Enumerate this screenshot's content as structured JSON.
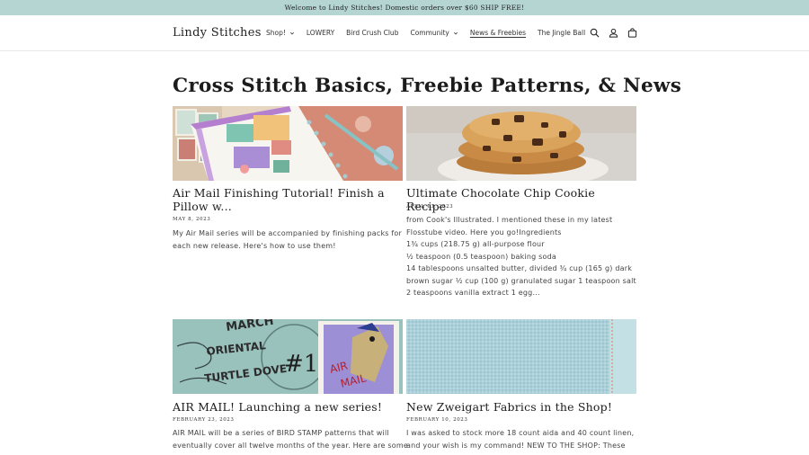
{
  "announcement": "Welcome to Lindy Stitches! Domestic orders over $60 SHIP FREE!",
  "header": {
    "logo": "Lindy Stitches",
    "nav": [
      {
        "label": "Shop!",
        "has_dropdown": true,
        "active": false
      },
      {
        "label": "LOWERY",
        "has_dropdown": false,
        "active": false
      },
      {
        "label": "Bird Crush Club",
        "has_dropdown": false,
        "active": false
      },
      {
        "label": "Community",
        "has_dropdown": true,
        "active": false
      },
      {
        "label": "News & Freebies",
        "has_dropdown": false,
        "active": true
      },
      {
        "label": "The Jingle Ball",
        "has_dropdown": false,
        "active": false
      }
    ],
    "icons": [
      "search-icon",
      "account-icon",
      "cart-icon"
    ]
  },
  "page_title": "Cross Stitch Basics, Freebie Patterns, & News",
  "articles": [
    {
      "title_lines": [
        "Air Mail Finishing Tutorial! Finish a",
        "Pillow w..."
      ],
      "date": "MAY 8, 2023",
      "excerpt_lines": [
        "My Air Mail series will be accompanied by finishing packs for",
        "each new release.  Here's how to use them!"
      ],
      "image": "cross-stitch-pillow-image"
    },
    {
      "title_lines": [
        "Ultimate Chocolate Chip Cookie Recipe"
      ],
      "date": "APRIL 13, 2023",
      "excerpt_lines": [
        "from Cook's Illustrated.  I mentioned these in my latest",
        "Flosstube video.  Here you go!Ingredients",
        "1¾ cups (218.75 g) all-purpose flour",
        "½ teaspoon (0.5 teaspoon) baking soda",
        "14 tablespoons unsalted butter, divided ¾ cup (165 g) dark",
        "brown sugar ½ cup (100 g) granulated sugar 1 teaspoon salt",
        "2 teaspoons vanilla extract 1 egg..."
      ],
      "image": "cookie-image"
    },
    {
      "title_lines": [
        "AIR MAIL! Launching a new series!"
      ],
      "date": "FEBRUARY 23, 2023",
      "excerpt_lines": [
        "AIR MAIL will be a series of BIRD STAMP patterns that will",
        "eventually cover all twelve months of the year.  Here are some"
      ],
      "image": "air-mail-stamp-image",
      "image_text": {
        "month": "MARCH",
        "line1": "ORIENTAL",
        "line2": "TURTLE DOVE",
        "number": "#1",
        "stamp1": "AIR",
        "stamp2": "MAIL"
      }
    },
    {
      "title_lines": [
        "New Zweigart Fabrics in the Shop!"
      ],
      "date": "FEBRUARY 10, 2023",
      "excerpt_lines": [
        "I was asked to stock more 18 count aida and 40 count linen,",
        "and your wish is my command!  NEW TO THE SHOP: These"
      ],
      "image": "fabric-image"
    }
  ],
  "colors": {
    "announcement_bg": "#b5d5d3",
    "text": "#1c1c1c",
    "fabric": "#a9cfd8",
    "stamp_purple": "#9c8fd6"
  }
}
